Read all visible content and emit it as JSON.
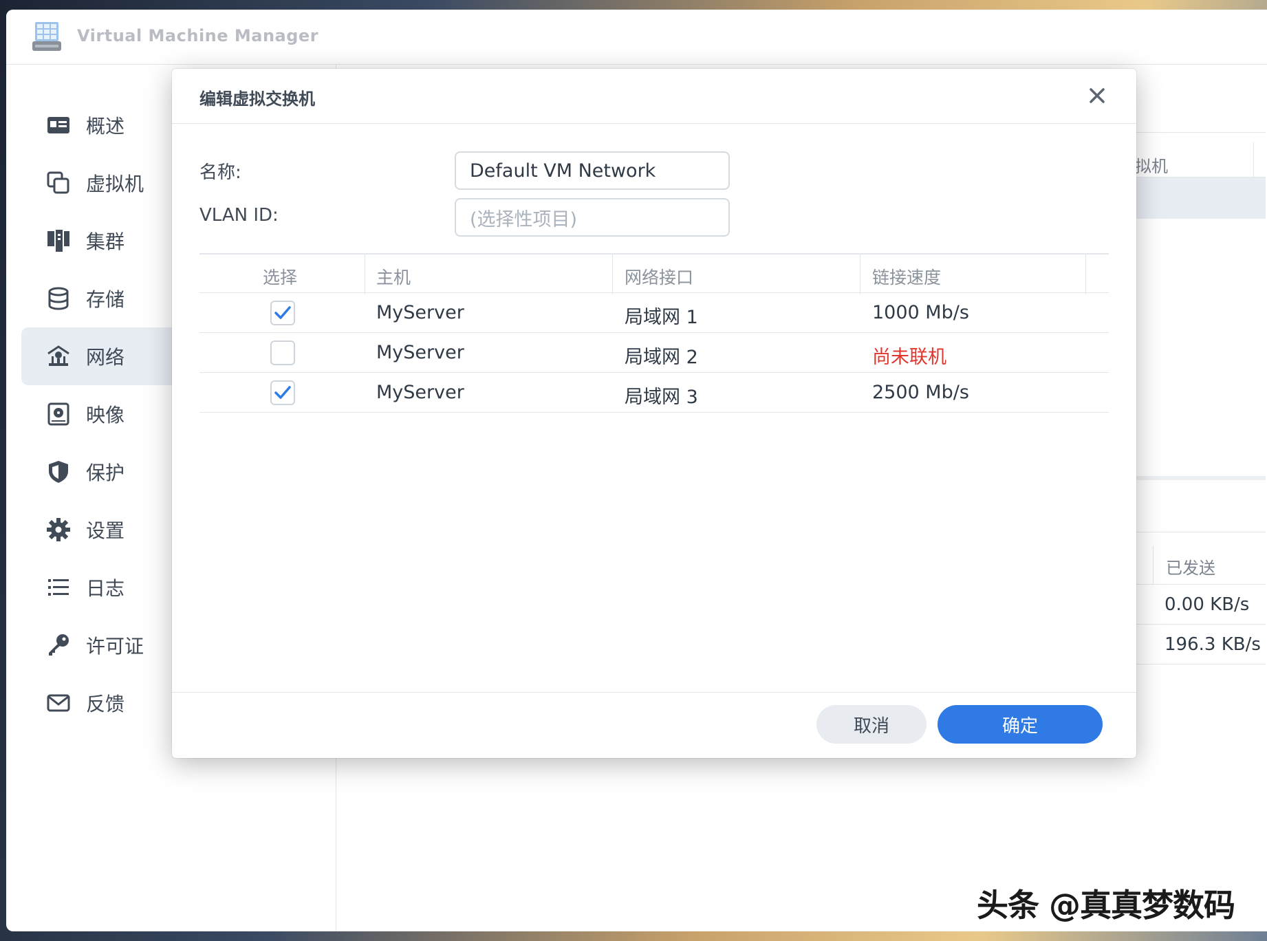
{
  "app": {
    "title": "Virtual Machine Manager"
  },
  "sidebar": {
    "items": [
      {
        "label": "概述",
        "icon": "overview-icon"
      },
      {
        "label": "虚拟机",
        "icon": "vm-icon"
      },
      {
        "label": "集群",
        "icon": "cluster-icon"
      },
      {
        "label": "存储",
        "icon": "storage-icon"
      },
      {
        "label": "网络",
        "icon": "network-icon",
        "active": true
      },
      {
        "label": "映像",
        "icon": "image-icon"
      },
      {
        "label": "保护",
        "icon": "shield-icon"
      },
      {
        "label": "设置",
        "icon": "gear-icon"
      },
      {
        "label": "日志",
        "icon": "list-icon"
      },
      {
        "label": "许可证",
        "icon": "key-icon"
      },
      {
        "label": "反馈",
        "icon": "mail-icon"
      }
    ]
  },
  "background": {
    "col_vm": "拟机",
    "col_sent": "已发送",
    "sent_values": [
      "0.00 KB/s",
      "196.3 KB/s"
    ]
  },
  "dialog": {
    "title": "编辑虚拟交换机",
    "name_label": "名称:",
    "name_value": "Default VM Network",
    "vlan_label": "VLAN ID:",
    "vlan_placeholder": "(选择性项目)",
    "columns": [
      "选择",
      "主机",
      "网络接口",
      "链接速度"
    ],
    "rows": [
      {
        "checked": true,
        "host": "MyServer",
        "interface": "局域网 1",
        "speed": "1000 Mb/s"
      },
      {
        "checked": false,
        "host": "MyServer",
        "interface": "局域网 2",
        "speed": "尚未联机",
        "speed_status": "offline"
      },
      {
        "checked": true,
        "host": "MyServer",
        "interface": "局域网 3",
        "speed": "2500 Mb/s"
      }
    ],
    "cancel_label": "取消",
    "ok_label": "确定"
  },
  "watermark": "头条 @真真梦数码",
  "colors": {
    "accent": "#2f7ae5",
    "warning": "#e0362d",
    "active_nav": "#e8edf3"
  }
}
